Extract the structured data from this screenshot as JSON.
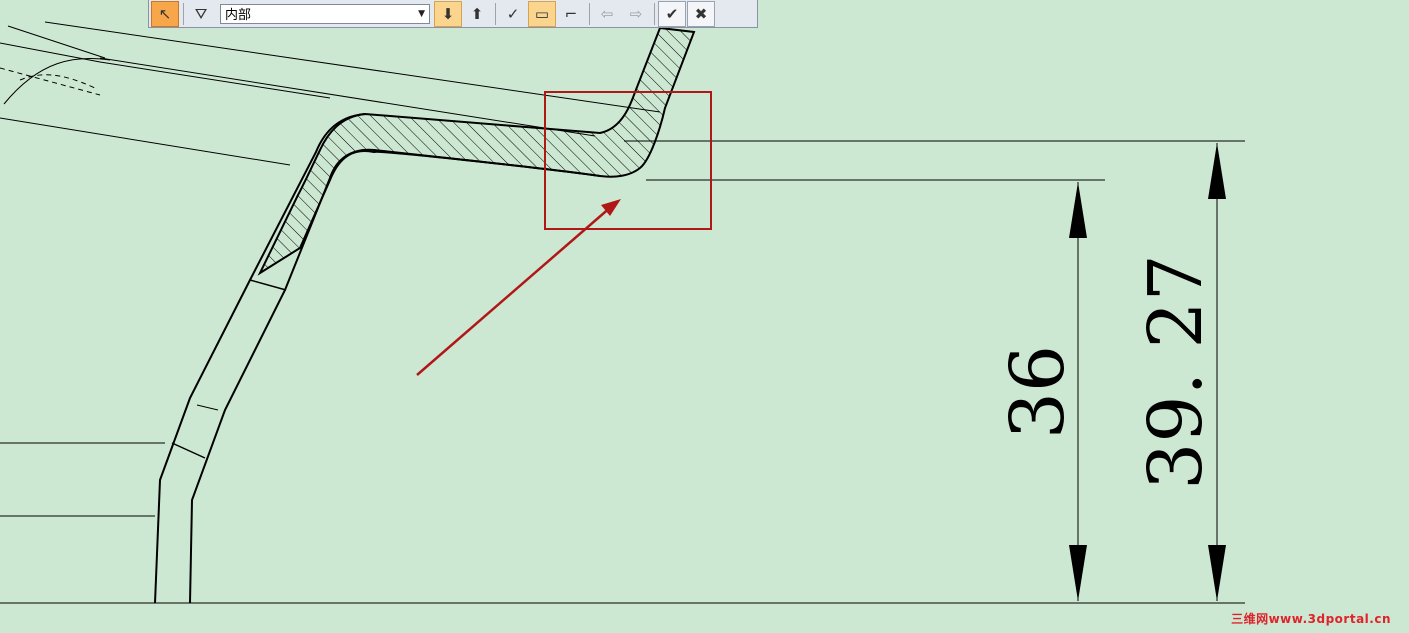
{
  "toolbar": {
    "filter_value": "内部",
    "buttons": [
      {
        "name": "select-arrow-button",
        "icon": "cursor-arrow-icon",
        "glyph": "↖",
        "state": "active"
      },
      {
        "name": "filter-button",
        "icon": "filter-funnel-icon",
        "glyph": "⛛",
        "state": "normal"
      },
      {
        "name": "place-down-button",
        "icon": "layer-down-icon",
        "glyph": "⬇",
        "state": "hl"
      },
      {
        "name": "place-up-button",
        "icon": "layer-up-icon",
        "glyph": "⬆",
        "state": "normal"
      },
      {
        "name": "check-select-button",
        "icon": "check-arrow-icon",
        "glyph": "✓",
        "state": "normal"
      },
      {
        "name": "rect-select-button",
        "icon": "rectangle-icon",
        "glyph": "▭",
        "state": "hl"
      },
      {
        "name": "region-select-button",
        "icon": "region-icon",
        "glyph": "⌐",
        "state": "normal"
      },
      {
        "name": "back-button",
        "icon": "arrow-left-icon",
        "glyph": "⇦",
        "state": "gray"
      },
      {
        "name": "forward-button",
        "icon": "arrow-right-icon",
        "glyph": "⇨",
        "state": "gray"
      },
      {
        "name": "accept-button",
        "icon": "checkmark-icon",
        "glyph": "✔",
        "state": "framed"
      },
      {
        "name": "cancel-button",
        "icon": "close-icon",
        "glyph": "✖",
        "state": "framed"
      }
    ]
  },
  "drawing": {
    "dimension_inner": "36",
    "dimension_outer": "39. 27",
    "line_color": "#000000",
    "callout_color": "#b01818"
  },
  "watermark": "三维网www.3dportal.cn"
}
